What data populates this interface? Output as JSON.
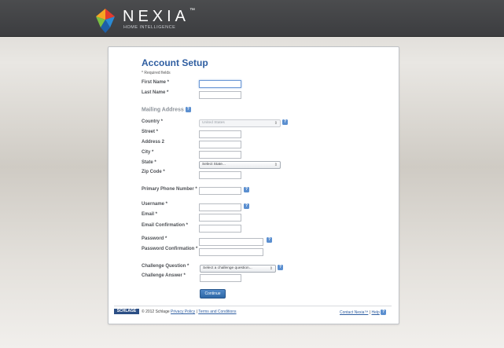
{
  "brand": {
    "name": "NEXIA",
    "trademark": "™",
    "tagline": "HOME INTELLIGENCE"
  },
  "colors": {
    "header_bg": "#3f4043",
    "title": "#2f5ea1",
    "accent": "#5b8fd0",
    "button": "#3a75b6",
    "schlage": "#2c4f85"
  },
  "form": {
    "title": "Account Setup",
    "required_note": "* Required fields",
    "first_name_label": "First Name *",
    "last_name_label": "Last Name *",
    "mailing_section": "Mailing Address",
    "country_label": "Country *",
    "country_value": "United States",
    "street_label": "Street *",
    "address2_label": "Address 2",
    "city_label": "City *",
    "state_label": "State *",
    "state_value": "Select State...",
    "zip_label": "Zip Code *",
    "phone_label": "Primary Phone Number *",
    "username_label": "Username *",
    "email_label": "Email *",
    "email_confirm_label": "Email Confirmation *",
    "password_label": "Password *",
    "password_confirm_label": "Password Confirmation *",
    "challenge_question_label": "Challenge Question *",
    "challenge_question_value": "Select a challenge question...",
    "challenge_answer_label": "Challenge Answer *",
    "continue_label": "Continue",
    "help_glyph": "?",
    "arrow_glyph": "⇕"
  },
  "footer": {
    "schlage_logo": "SCHLAGE",
    "copyright": "© 2012 Schlage",
    "privacy_link": "Privacy Policy",
    "separator": "|",
    "terms_link": "Terms and Conditions",
    "contact_link": "Contact Nexia™",
    "help_link": "Help"
  }
}
